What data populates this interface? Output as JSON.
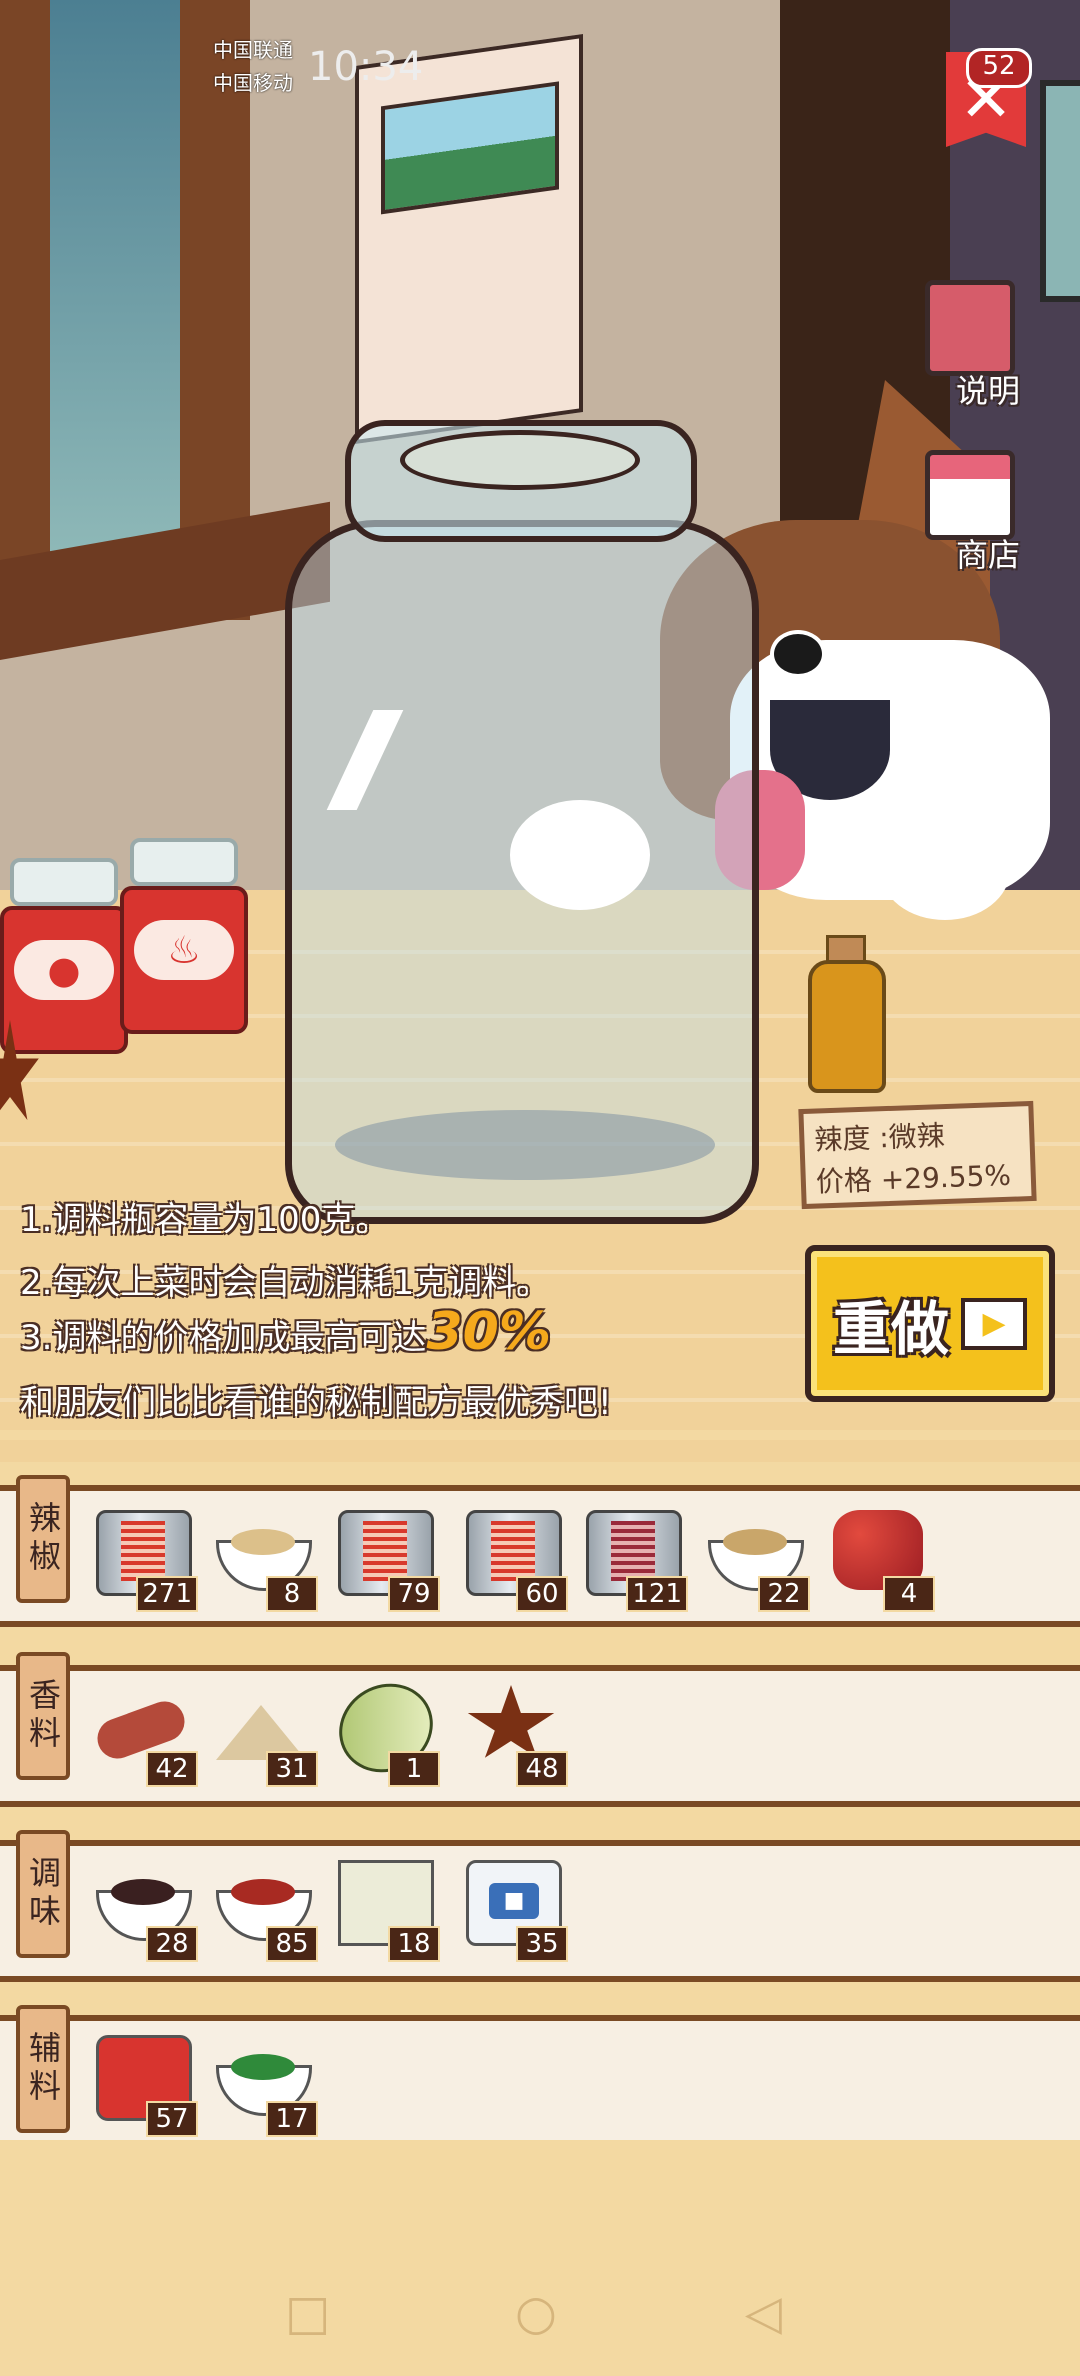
{
  "status_bar": {
    "carrier_1": "中国联通",
    "carrier_2": "中国移动",
    "time": "10:34"
  },
  "close_button": {
    "count": "52",
    "icon": "close-icon"
  },
  "side_buttons": [
    {
      "label": "说明",
      "icon": "book-icon"
    },
    {
      "label": "商店",
      "icon": "shop-icon"
    }
  ],
  "seasoning_info": {
    "spiciness": "辣度 :微辣",
    "price_bonus": "价格 +29.55%"
  },
  "tips": {
    "line1": "1.调料瓶容量为100克。",
    "line2": "2.每次上菜时会自动消耗1克调料。",
    "line3_prefix": "3.调料的价格加成最高可达",
    "line3_highlight": "30%",
    "line4": "和朋友们比比看谁的秘制配方最优秀吧!"
  },
  "redo_button": {
    "label": "重做",
    "icon": "play-icon"
  },
  "shelves": [
    {
      "category": "辣椒",
      "items": [
        {
          "icon": "chili-can-icon",
          "count": "271"
        },
        {
          "icon": "chili-powder-bowl-icon",
          "count": "8"
        },
        {
          "icon": "chili-can-icon",
          "count": "79"
        },
        {
          "icon": "chili-can-icon",
          "count": "60"
        },
        {
          "icon": "chili-can-icon",
          "count": "121"
        },
        {
          "icon": "chili-powder-bowl-icon",
          "count": "22"
        },
        {
          "icon": "sichuan-pepper-icon",
          "count": "4"
        }
      ]
    },
    {
      "category": "香料",
      "items": [
        {
          "icon": "ginger-root-icon",
          "count": "42"
        },
        {
          "icon": "spice-powder-icon",
          "count": "31"
        },
        {
          "icon": "cardamom-icon",
          "count": "1"
        },
        {
          "icon": "star-anise-icon",
          "count": "48"
        }
      ]
    },
    {
      "category": "调味",
      "items": [
        {
          "icon": "soy-sauce-bowl-icon",
          "count": "28"
        },
        {
          "icon": "chili-sauce-bowl-icon",
          "count": "85"
        },
        {
          "icon": "tofu-icon",
          "count": "18"
        },
        {
          "icon": "salt-bag-icon",
          "count": "35"
        }
      ]
    },
    {
      "category": "辅料",
      "items": [
        {
          "icon": "tomato-jar-icon",
          "count": "57"
        },
        {
          "icon": "herbs-bowl-icon",
          "count": "17"
        }
      ]
    }
  ],
  "nav_bar": {
    "square": "□",
    "circle": "○",
    "back": "◁"
  }
}
